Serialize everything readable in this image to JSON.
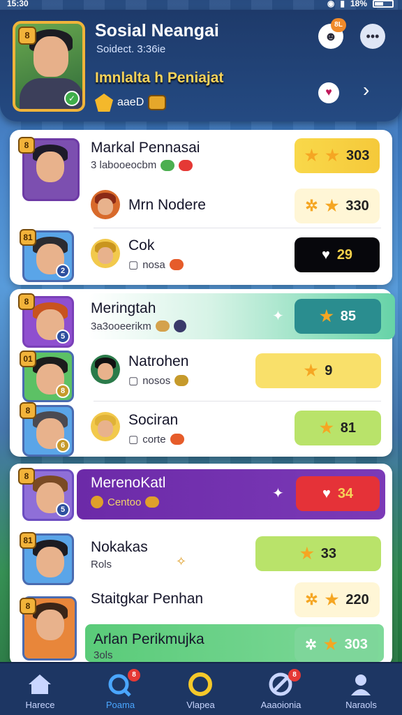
{
  "status": {
    "time": "15:30",
    "battery": "18%"
  },
  "header": {
    "title": "Sosial Neangai",
    "subtitle": "Soidect. 3:36ie",
    "hero_name": "Imnlalta h Peniajat",
    "coins": "aaeD",
    "hero_rank": "8",
    "notif_badge": "8L"
  },
  "leaderboard": [
    {
      "name": "Markal Pennasai",
      "meta": "3 labooeocbm",
      "score": "303",
      "rank": "8",
      "level": "",
      "style": "gold"
    },
    {
      "name": "Mrn Nodere",
      "meta": "",
      "score": "330",
      "style": "cream"
    },
    {
      "name": "Cok",
      "meta": "nosa",
      "score": "29",
      "rank": "81",
      "level": "2",
      "style": "black"
    },
    {
      "name": "Meringtah",
      "meta": "3a3ooeerikm",
      "score": "85",
      "rank": "8",
      "level": "5",
      "style": "teal"
    },
    {
      "name": "Natrohen",
      "meta": "nosos",
      "score": "9",
      "rank": "01",
      "level": "8",
      "style": "yellow"
    },
    {
      "name": "Sociran",
      "meta": "corte",
      "score": "81",
      "rank": "8",
      "level": "6",
      "style": "lime"
    },
    {
      "name": "MerenoKatl",
      "meta": "Centoo",
      "score": "34",
      "rank": "8",
      "level": "5",
      "style": "purple"
    },
    {
      "name": "Nokakas",
      "meta": "Rols",
      "score": "33",
      "rank": "81",
      "level": "",
      "style": "lime"
    },
    {
      "name": "Staitgkar Penhan",
      "meta": "",
      "score": "220",
      "rank": "8",
      "level": "",
      "style": "cream"
    },
    {
      "name": "Arlan Perikmujka",
      "meta": "3ols",
      "score": "303",
      "style": "green"
    }
  ],
  "tabs": [
    {
      "label": "Harece",
      "icon": "home-icon"
    },
    {
      "label": "Poama",
      "icon": "search-icon",
      "badge": "8"
    },
    {
      "label": "Vlapea",
      "icon": "ring-icon"
    },
    {
      "label": "Aaaoionia",
      "icon": "crossed-icon",
      "badge": "8"
    },
    {
      "label": "Naraols",
      "icon": "profile-icon"
    }
  ],
  "colors": {
    "accent": "#4aa6ff",
    "gold": "#f7d35a",
    "purple": "#6c2aa8",
    "teal": "#2f8f8e"
  }
}
